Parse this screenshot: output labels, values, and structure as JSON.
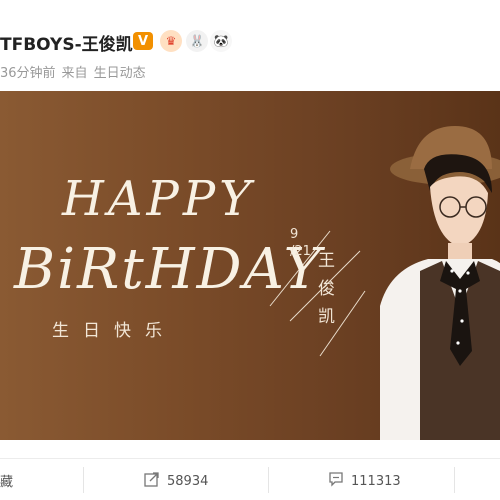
{
  "post": {
    "author": "TFBOYS-王俊凯",
    "time": "36分钟前",
    "source_prefix": "来自",
    "source": "生日动态"
  },
  "badges": [
    "verified-v",
    "crown",
    "bunny",
    "panda"
  ],
  "banner": {
    "title_line1": "HAPPY",
    "title_line2": "BiRtHDAY",
    "subtitle": "生日快乐",
    "date_month": "9",
    "date_day": "/21",
    "name_vertical": "王俊凯"
  },
  "actions": {
    "favorite_label": "藏",
    "repost_count": "58934",
    "comment_count": "111313"
  },
  "colors": {
    "banner_brown": "#6a3f22",
    "verified_orange": "#f29000",
    "text_cream": "#f8f1e4"
  }
}
